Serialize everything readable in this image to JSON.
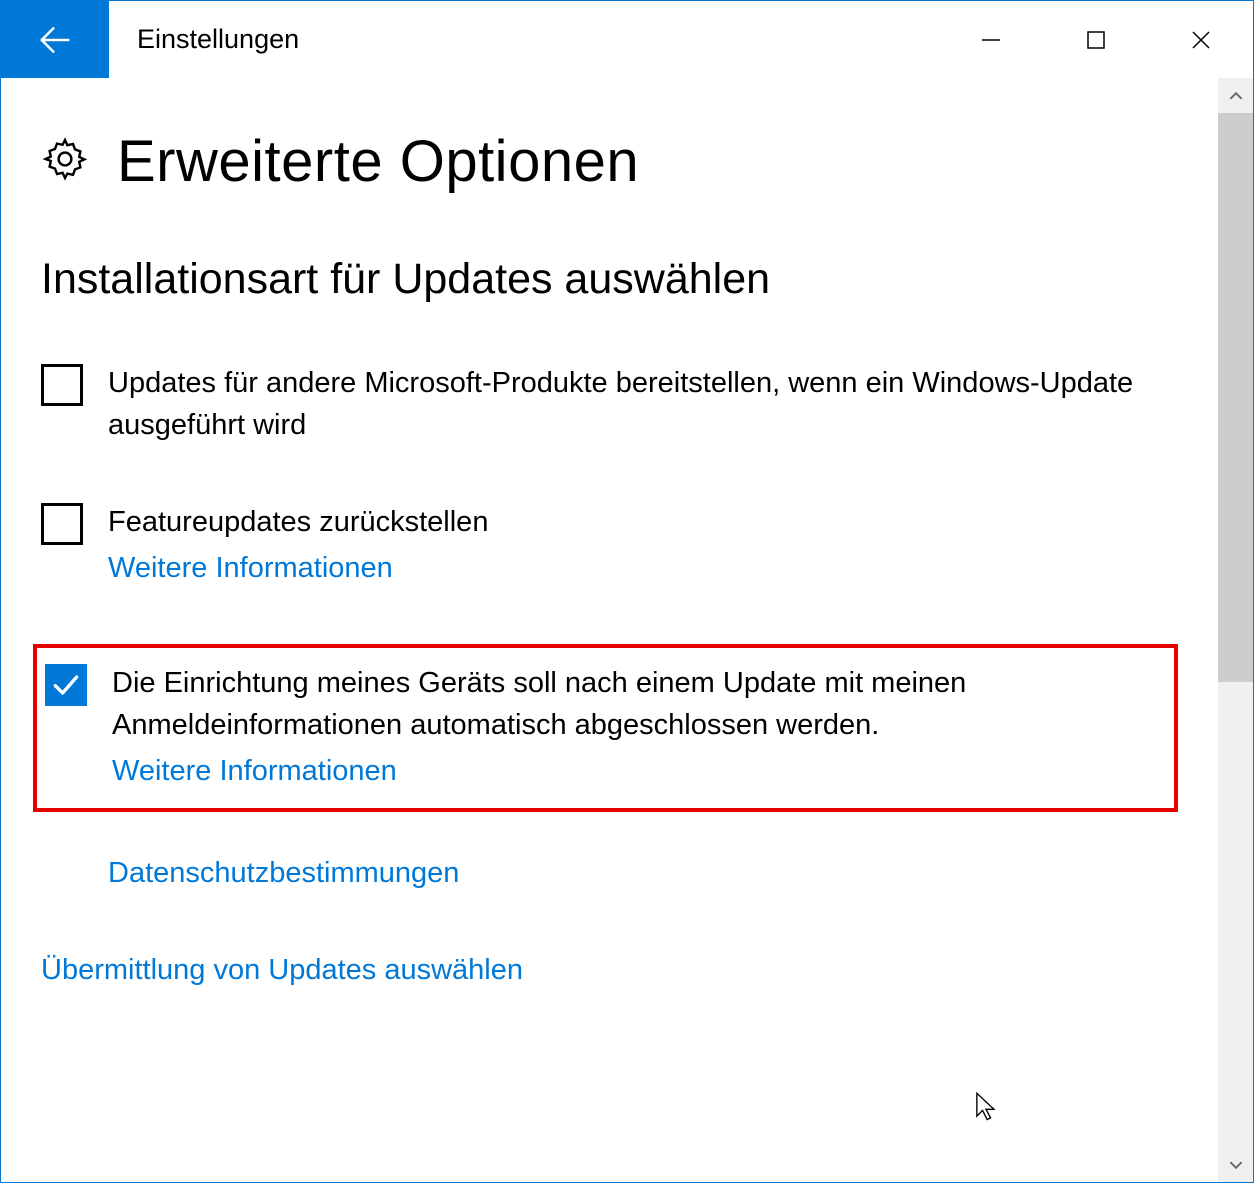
{
  "titlebar": {
    "title": "Einstellungen"
  },
  "page": {
    "heading": "Erweiterte Optionen",
    "section_heading": "Installationsart für Updates auswählen"
  },
  "options": {
    "opt1_label": "Updates für andere Microsoft-Produkte bereitstellen, wenn ein Windows-Update ausgeführt wird",
    "opt2_label": "Featureupdates zurückstellen",
    "opt2_link": "Weitere Informationen",
    "opt3_label": "Die Einrichtung meines Geräts soll nach einem Update mit meinen Anmeldeinformationen automatisch abgeschlossen werden.",
    "opt3_link": "Weitere Informationen"
  },
  "links": {
    "privacy": "Datenschutzbestimmungen",
    "delivery": "Übermittlung von Updates auswählen"
  }
}
